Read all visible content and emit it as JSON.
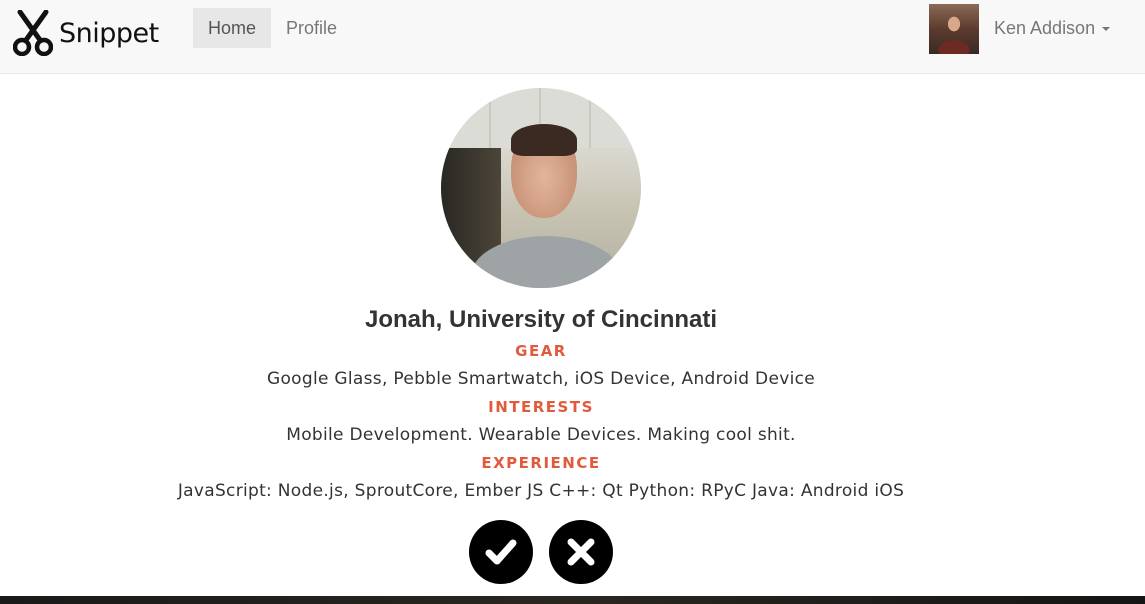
{
  "app": {
    "brand": "Snippet"
  },
  "nav": {
    "links": [
      {
        "label": "Home",
        "active": true
      },
      {
        "label": "Profile",
        "active": false
      }
    ],
    "user": {
      "name": "Ken Addison"
    }
  },
  "profile": {
    "name": "Jonah, University of Cincinnati",
    "sections": {
      "gear": {
        "title": "GEAR",
        "text": "Google Glass, Pebble Smartwatch, iOS Device, Android Device"
      },
      "interests": {
        "title": "INTERESTS",
        "text": "Mobile Development. Wearable Devices. Making cool shit."
      },
      "experience": {
        "title": "EXPERIENCE",
        "text": "JavaScript: Node.js, SproutCore, Ember JS C++: Qt Python: RPyC Java: Android iOS"
      }
    }
  },
  "actions": {
    "accept_icon": "check-icon",
    "reject_icon": "close-icon"
  },
  "colors": {
    "accent": "#e15a3c",
    "navbar_bg": "#f8f8f8",
    "active_nav_bg": "#e7e7e7"
  }
}
